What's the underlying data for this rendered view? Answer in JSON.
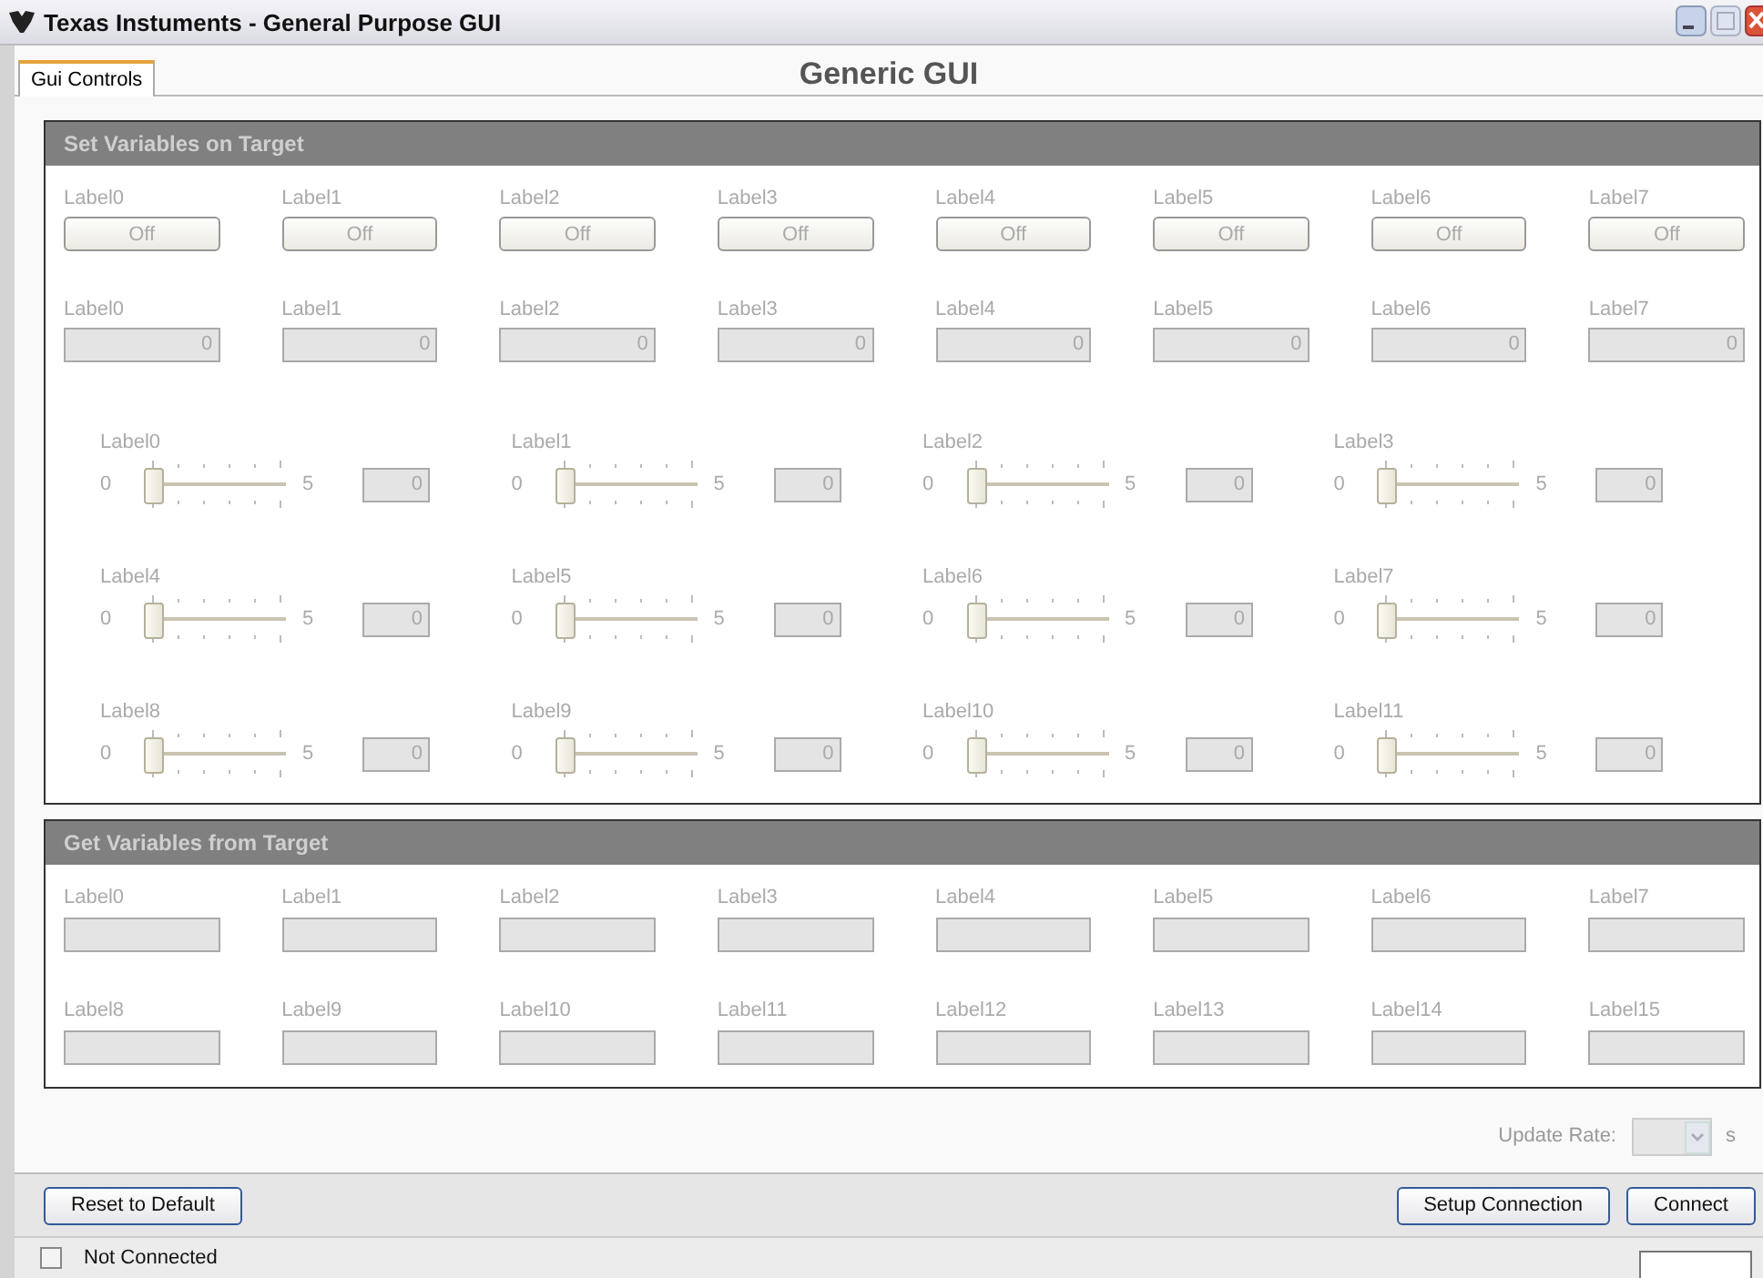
{
  "window": {
    "title": "Texas Instuments - General Purpose GUI"
  },
  "tabs": [
    {
      "label": "Gui Controls",
      "selected": true
    }
  ],
  "heading": "Generic GUI",
  "set_panel": {
    "title": "Set Variables on Target",
    "disabled": true,
    "toggles": [
      {
        "label": "Label0",
        "value": "Off"
      },
      {
        "label": "Label1",
        "value": "Off"
      },
      {
        "label": "Label2",
        "value": "Off"
      },
      {
        "label": "Label3",
        "value": "Off"
      },
      {
        "label": "Label4",
        "value": "Off"
      },
      {
        "label": "Label5",
        "value": "Off"
      },
      {
        "label": "Label6",
        "value": "Off"
      },
      {
        "label": "Label7",
        "value": "Off"
      }
    ],
    "fields": [
      {
        "label": "Label0",
        "value": "0"
      },
      {
        "label": "Label1",
        "value": "0"
      },
      {
        "label": "Label2",
        "value": "0"
      },
      {
        "label": "Label3",
        "value": "0"
      },
      {
        "label": "Label4",
        "value": "0"
      },
      {
        "label": "Label5",
        "value": "0"
      },
      {
        "label": "Label6",
        "value": "0"
      },
      {
        "label": "Label7",
        "value": "0"
      }
    ],
    "sliders": [
      {
        "label": "Label0",
        "min": "0",
        "max": "5",
        "level": 0,
        "value": "0"
      },
      {
        "label": "Label1",
        "min": "0",
        "max": "5",
        "level": 0,
        "value": "0"
      },
      {
        "label": "Label2",
        "min": "0",
        "max": "5",
        "level": 0,
        "value": "0"
      },
      {
        "label": "Label3",
        "min": "0",
        "max": "5",
        "level": 0,
        "value": "0"
      },
      {
        "label": "Label4",
        "min": "0",
        "max": "5",
        "level": 0,
        "value": "0"
      },
      {
        "label": "Label5",
        "min": "0",
        "max": "5",
        "level": 0,
        "value": "0"
      },
      {
        "label": "Label6",
        "min": "0",
        "max": "5",
        "level": 0,
        "value": "0"
      },
      {
        "label": "Label7",
        "min": "0",
        "max": "5",
        "level": 0,
        "value": "0"
      },
      {
        "label": "Label8",
        "min": "0",
        "max": "5",
        "level": 0,
        "value": "0"
      },
      {
        "label": "Label9",
        "min": "0",
        "max": "5",
        "level": 0,
        "value": "0"
      },
      {
        "label": "Label10",
        "min": "0",
        "max": "5",
        "level": 0,
        "value": "0"
      },
      {
        "label": "Label11",
        "min": "0",
        "max": "5",
        "level": 0,
        "value": "0"
      }
    ]
  },
  "get_panel": {
    "title": "Get Variables from Target",
    "disabled": true,
    "outputs": [
      {
        "label": "Label0"
      },
      {
        "label": "Label1"
      },
      {
        "label": "Label2"
      },
      {
        "label": "Label3"
      },
      {
        "label": "Label4"
      },
      {
        "label": "Label5"
      },
      {
        "label": "Label6"
      },
      {
        "label": "Label7"
      },
      {
        "label": "Label8"
      },
      {
        "label": "Label9"
      },
      {
        "label": "Label10"
      },
      {
        "label": "Label11"
      },
      {
        "label": "Label12"
      },
      {
        "label": "Label13"
      },
      {
        "label": "Label14"
      },
      {
        "label": "Label15"
      }
    ]
  },
  "update_rate": {
    "label": "Update Rate:",
    "unit": "s",
    "disabled": true
  },
  "buttons": [
    {
      "label": "Reset to Default",
      "kind": "left"
    },
    {
      "label": "Setup Connection",
      "kind": "right"
    },
    {
      "label": "Connect",
      "kind": "right"
    }
  ],
  "status_bar": {
    "checked": false,
    "text": "Not Connected"
  }
}
